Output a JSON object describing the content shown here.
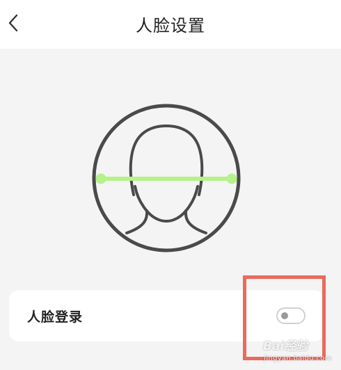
{
  "header": {
    "title": "人脸设置",
    "back_icon": "chevron-left-icon"
  },
  "illustration": {
    "icon": "face-scan-icon",
    "outline_color": "#4a4a4a",
    "scan_line_color": "#b5f28a"
  },
  "settings": {
    "face_login": {
      "label": "人脸登录",
      "enabled": false
    }
  },
  "annotation": {
    "highlight_color": "#ea6a5c"
  },
  "watermark": {
    "logo": "Bai经验",
    "url": "jingyan.baidu.com"
  }
}
